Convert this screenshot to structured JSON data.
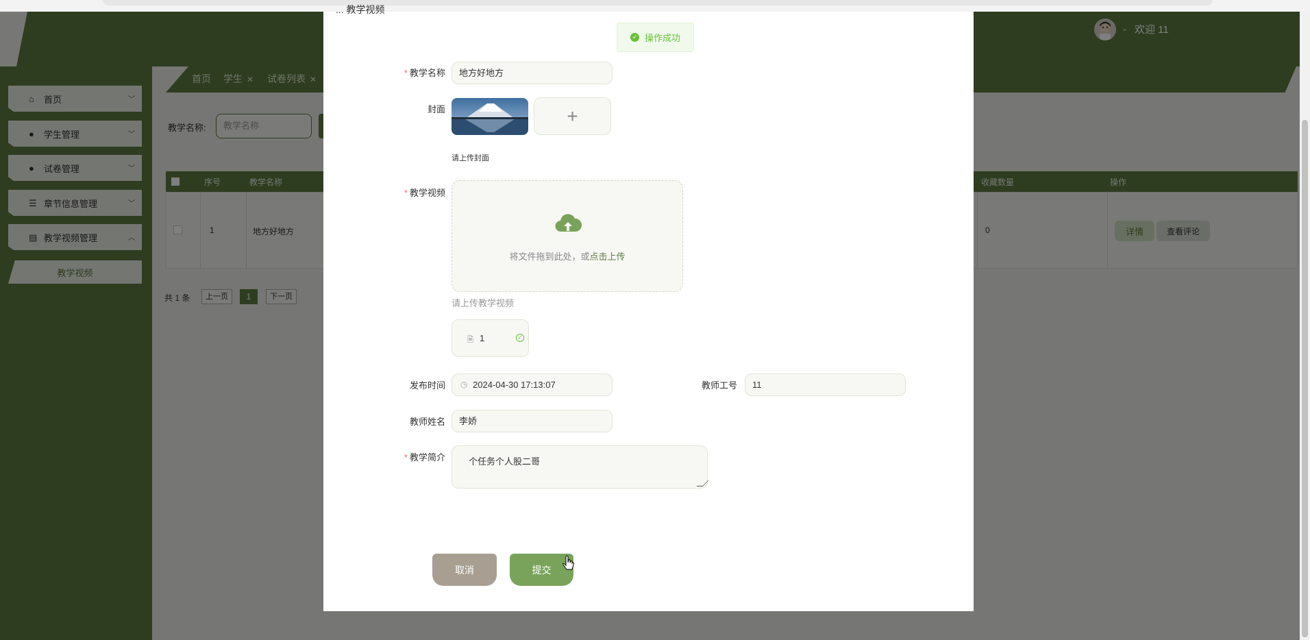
{
  "colors": {
    "primary": "#5d7a41",
    "success": "#67c23a",
    "cancel": "#a89e92",
    "submit": "#79a35a"
  },
  "header": {
    "welcome": "欢迎 11",
    "caret_icon": "chevron-down-icon"
  },
  "sidebar": {
    "items": [
      {
        "label": "首页",
        "icon": "home-icon"
      },
      {
        "label": "学生管理",
        "icon": "user-icon"
      },
      {
        "label": "试卷管理",
        "icon": "drop-icon"
      },
      {
        "label": "章节信息管理",
        "icon": "list-icon"
      },
      {
        "label": "教学视频管理",
        "icon": "box-icon"
      }
    ],
    "sub_item": "教学视频"
  },
  "tabs": [
    {
      "label": "首页"
    },
    {
      "label": "学生"
    },
    {
      "label": "试卷列表"
    }
  ],
  "filter": {
    "label": "教学名称:",
    "placeholder": "教学名称"
  },
  "table": {
    "headers": [
      "序号",
      "教学名称",
      "收藏数量",
      "操作"
    ],
    "row": {
      "index": "1",
      "name": "地方好地方",
      "favorites": "0",
      "detail": "详情",
      "comments": "查看评论"
    }
  },
  "pager": {
    "total": "共 1 条",
    "prev": "上一页",
    "current": "1",
    "next": "下一页"
  },
  "modal": {
    "title_fragment": "... 教学视频",
    "toast": "操作成功",
    "fields": {
      "name_label": "教学名称",
      "name_value": "地方好地方",
      "cover_label": "封面",
      "cover_hint": "请上传封面",
      "video_label": "教学视频",
      "drop_text_a": "将文件拖到此处，或",
      "drop_text_b": "点击上传",
      "video_hint": "请上传教学视频",
      "file_name": "1",
      "time_label": "发布时间",
      "time_value": "2024-04-30 17:13:07",
      "teacher_id_label": "教师工号",
      "teacher_id_value": "11",
      "teacher_name_label": "教师姓名",
      "teacher_name_value": "李娇",
      "intro_label": "教学简介",
      "intro_value": "个任务个人股二哥"
    },
    "buttons": {
      "cancel": "取消",
      "submit": "提交"
    }
  }
}
